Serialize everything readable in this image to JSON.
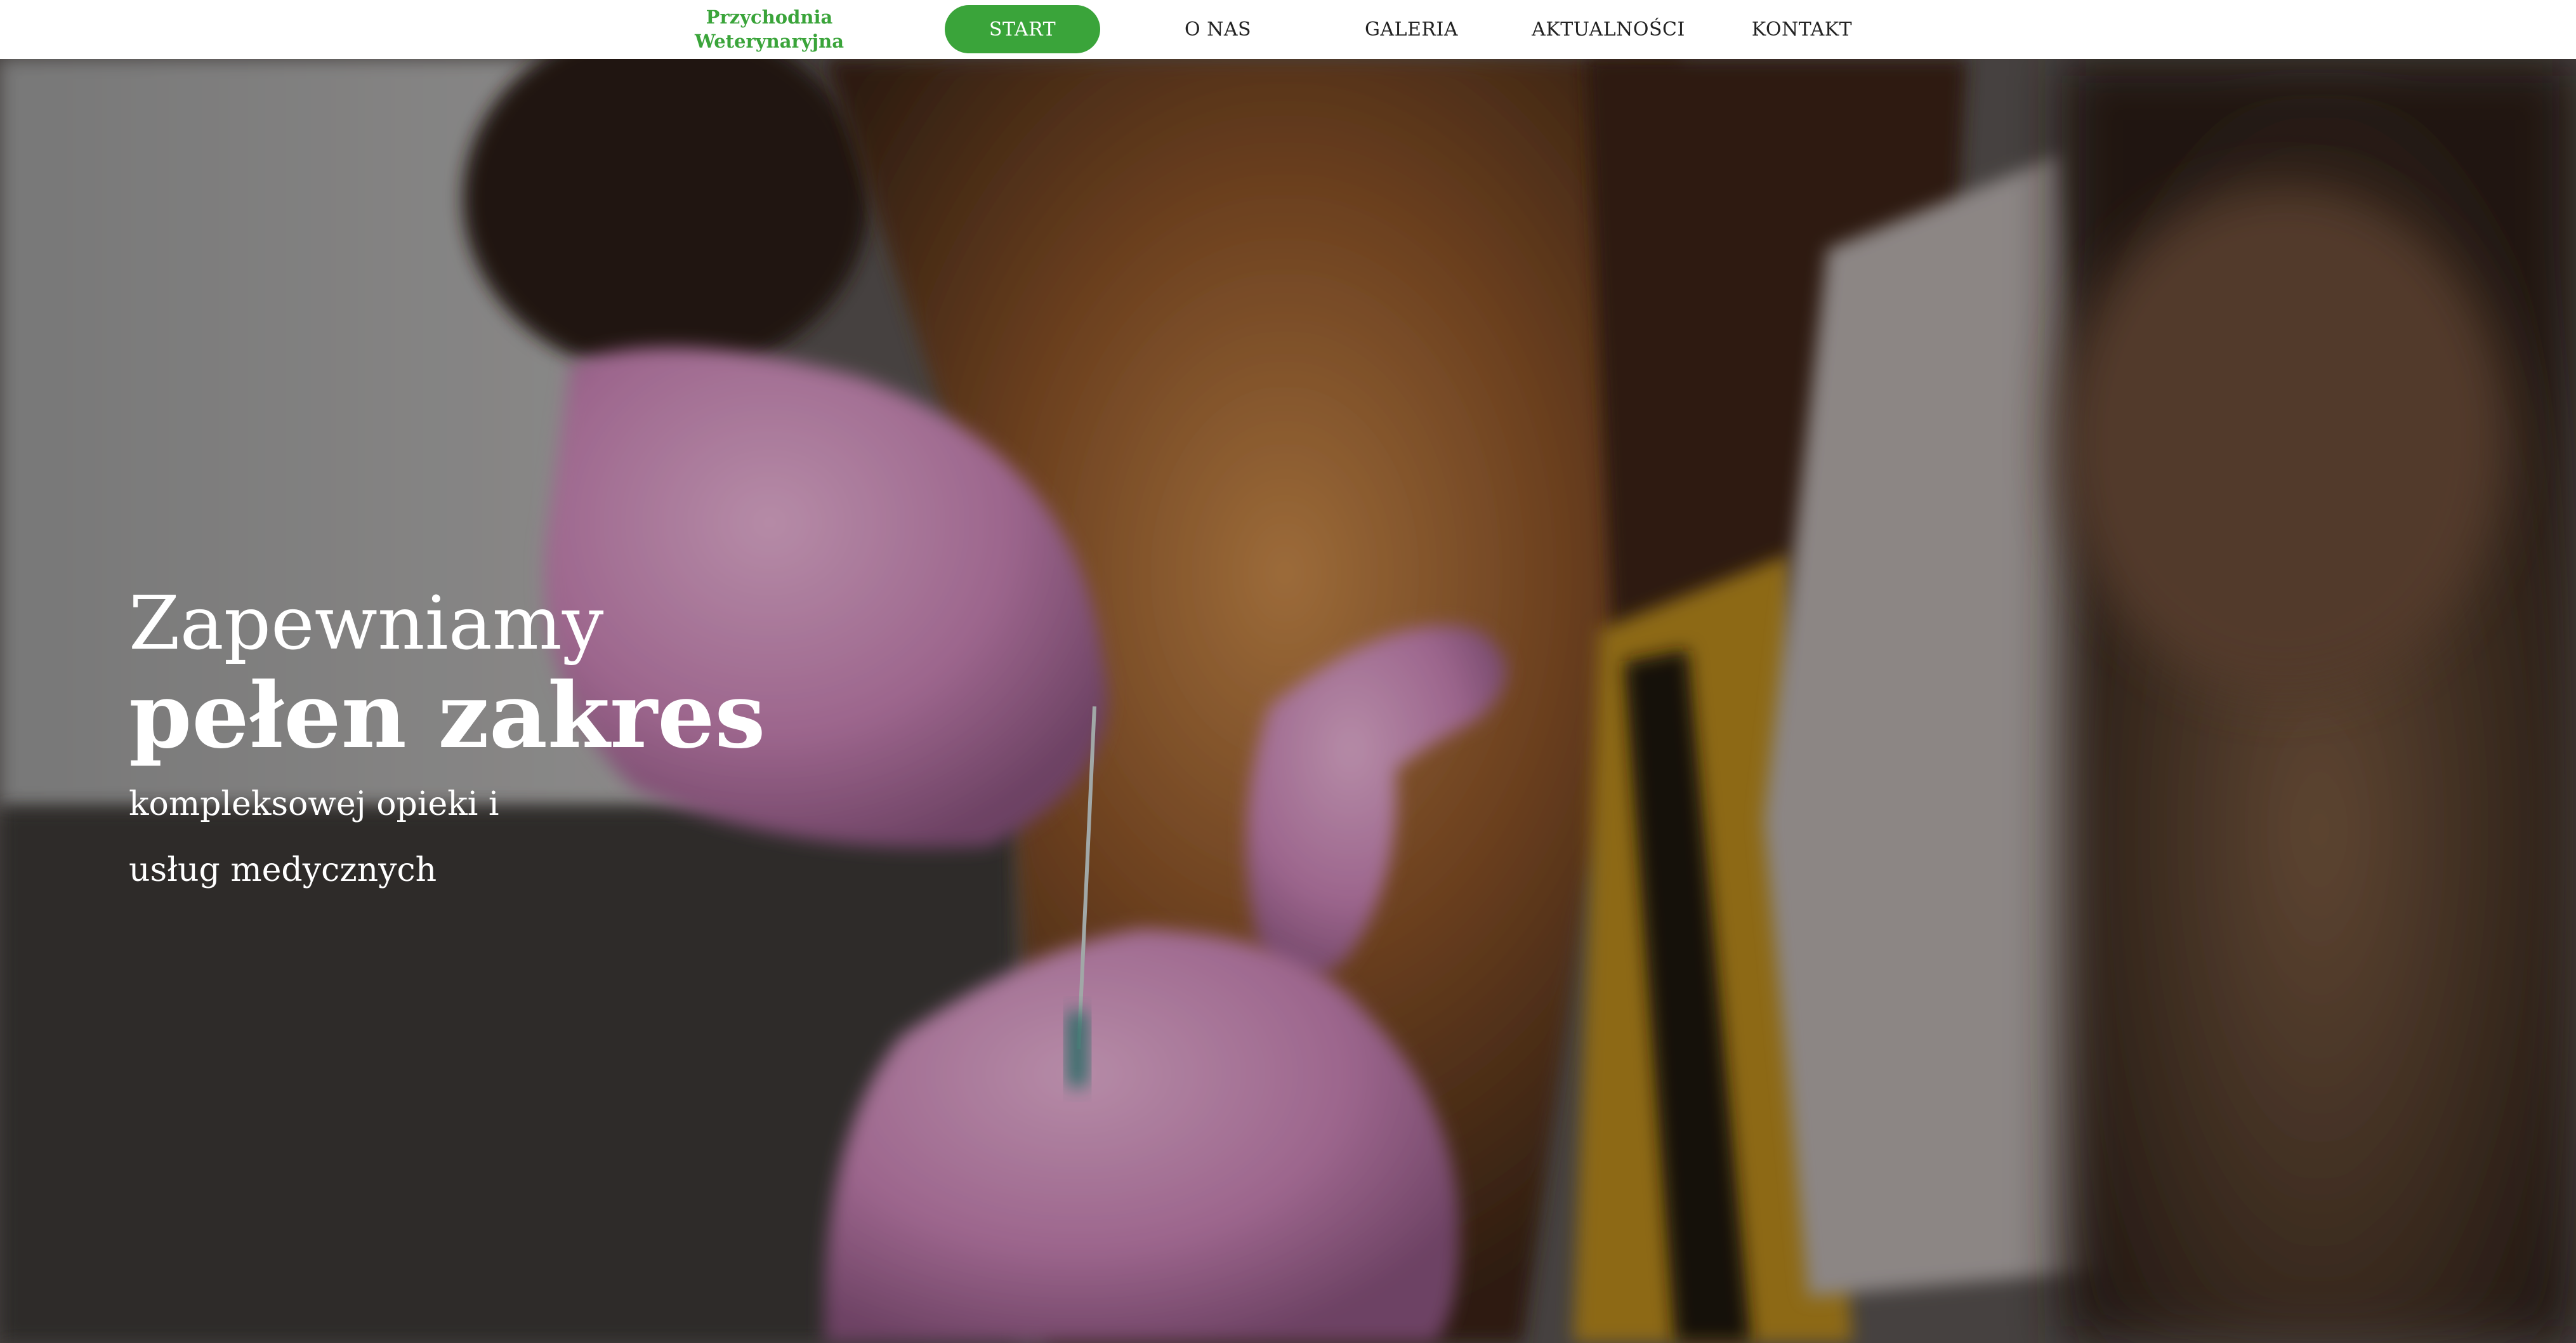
{
  "brand": {
    "line1": "Przychodnia",
    "line2": "Weterynaryjna",
    "color": "#3aa43a"
  },
  "nav": {
    "items": [
      {
        "label": "START",
        "active": true
      },
      {
        "label": "O NAS",
        "active": false
      },
      {
        "label": "GALERIA",
        "active": false
      },
      {
        "label": "AKTUALNOŚCI",
        "active": false
      },
      {
        "label": "KONTAKT",
        "active": false
      }
    ],
    "active_color": "#3aa43a"
  },
  "hero": {
    "title_line1": "Zapewniamy",
    "title_line2": "pełen zakres",
    "subtitle_line1": "kompleksowej opieki i",
    "subtitle_line2": "usług medycznych",
    "image": "veterinarian-taking-blood-sample-from-dog-paw"
  }
}
